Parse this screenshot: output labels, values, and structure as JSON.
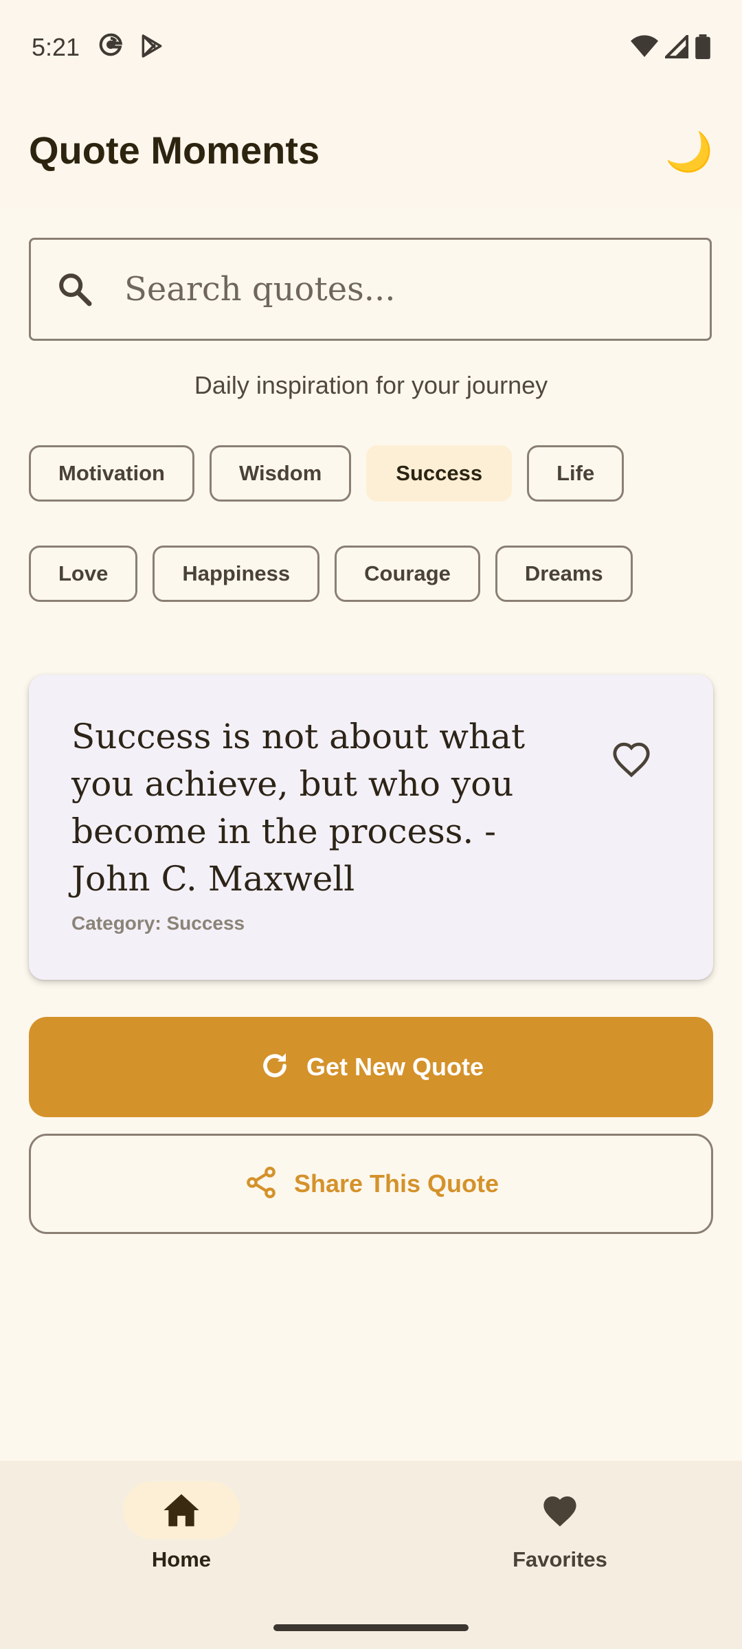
{
  "status_bar": {
    "time": "5:21"
  },
  "app": {
    "title": "Quote Moments",
    "theme_toggle_icon": "🌙"
  },
  "search": {
    "placeholder": "Search quotes..."
  },
  "tagline": "Daily inspiration for your journey",
  "categories": {
    "row1": [
      "Motivation",
      "Wisdom",
      "Success",
      "Life"
    ],
    "row2": [
      "Love",
      "Happiness",
      "Courage",
      "Dreams"
    ],
    "selected": "Success"
  },
  "quote_card": {
    "text": "Success is not about what you achieve, but who you become in the process. - John C. Maxwell",
    "category_label": "Category: Success"
  },
  "actions": {
    "new_quote": "Get New Quote",
    "share": "Share This Quote"
  },
  "bottom_nav": {
    "home": "Home",
    "favorites": "Favorites"
  },
  "colors": {
    "accent": "#D4922B",
    "background": "#FDF8EE",
    "card": "#F4F0F7",
    "selected_chip": "#FDEFD5"
  }
}
